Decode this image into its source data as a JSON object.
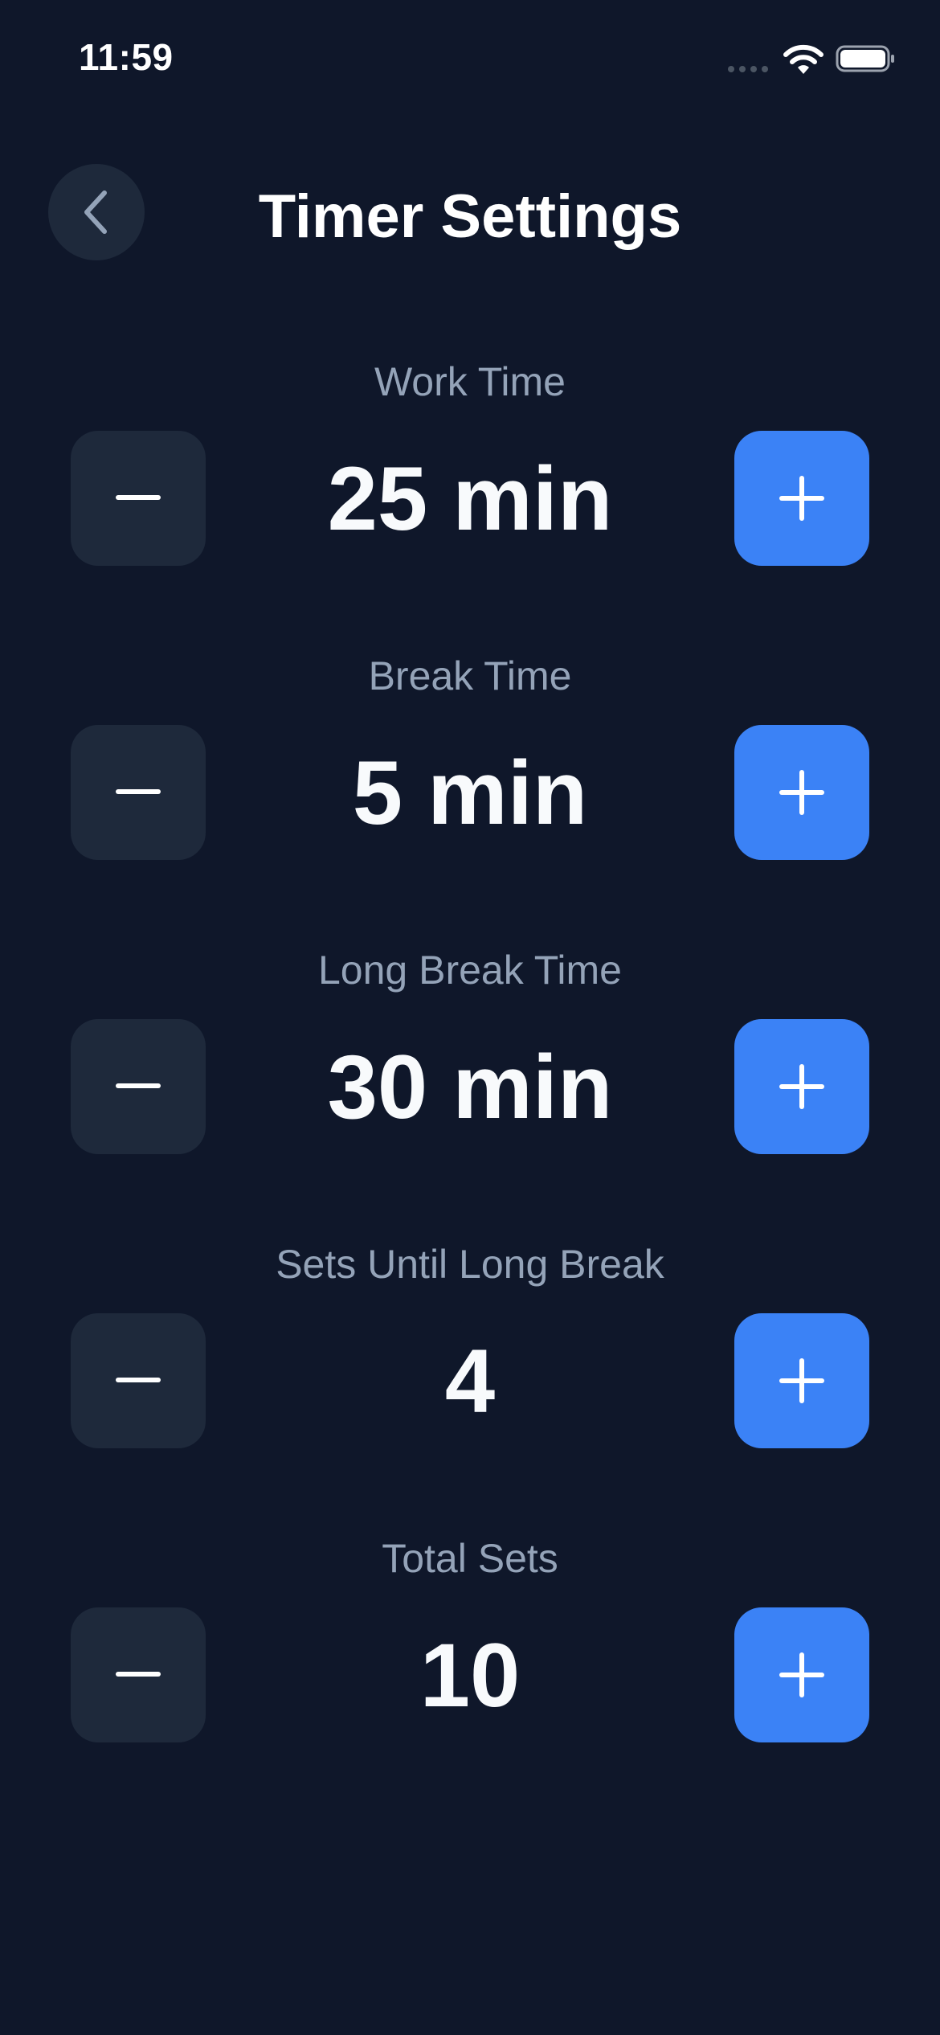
{
  "status_bar": {
    "time": "11:59"
  },
  "header": {
    "title": "Timer Settings",
    "back_icon": "chevron-left-icon"
  },
  "colors": {
    "background": "#0f172a",
    "minus_button": "#1e293b",
    "plus_button": "#3b82f6",
    "label": "#94a3b8",
    "value": "#f8fafc"
  },
  "settings": [
    {
      "label": "Work Time",
      "value": "25 min"
    },
    {
      "label": "Break Time",
      "value": "5 min"
    },
    {
      "label": "Long Break Time",
      "value": "30 min"
    },
    {
      "label": "Sets Until Long Break",
      "value": "4"
    },
    {
      "label": "Total Sets",
      "value": "10"
    }
  ]
}
